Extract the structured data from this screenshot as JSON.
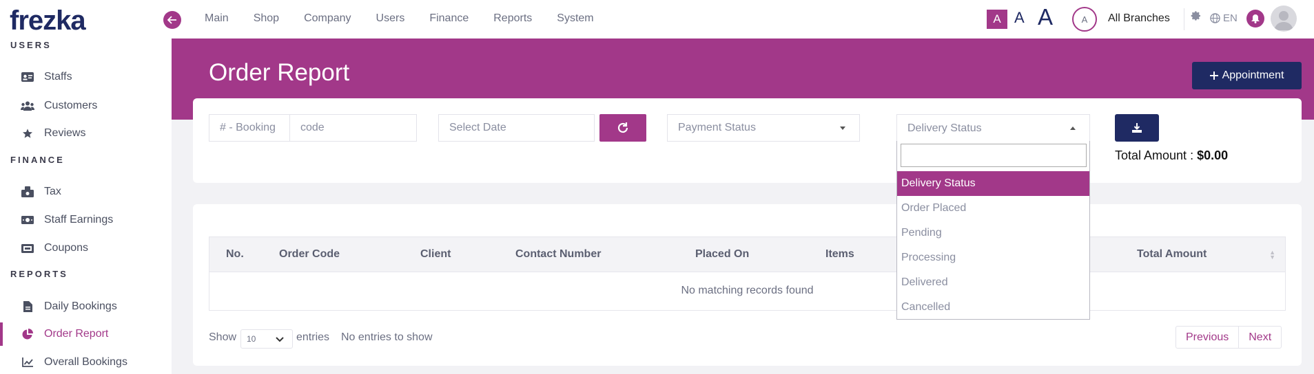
{
  "brand": {
    "logo": "frezka"
  },
  "sidebar": {
    "sections": [
      {
        "header": "USERS",
        "items": [
          {
            "label": "Staffs",
            "icon": "id-card-icon"
          },
          {
            "label": "Customers",
            "icon": "users-icon"
          },
          {
            "label": "Reviews",
            "icon": "star-icon"
          }
        ]
      },
      {
        "header": "FINANCE",
        "items": [
          {
            "label": "Tax",
            "icon": "tax-icon"
          },
          {
            "label": "Staff Earnings",
            "icon": "money-icon"
          },
          {
            "label": "Coupons",
            "icon": "ticket-icon"
          }
        ]
      },
      {
        "header": "REPORTS",
        "items": [
          {
            "label": "Daily Bookings",
            "icon": "file-icon"
          },
          {
            "label": "Order Report",
            "icon": "pie-chart-icon",
            "active": true
          },
          {
            "label": "Overall Bookings",
            "icon": "line-chart-icon"
          }
        ]
      }
    ]
  },
  "topnav": {
    "items": [
      "Main",
      "Shop",
      "Company",
      "Users",
      "Finance",
      "Reports",
      "System"
    ]
  },
  "topbar": {
    "font_sizes": [
      "A",
      "A",
      "A"
    ],
    "branch_avatar": "A",
    "branch_label": "All Branches",
    "language": "EN"
  },
  "page": {
    "title": "Order Report",
    "appointment_button": "Appointment"
  },
  "filters": {
    "booking_prefix": "# - Booking",
    "code_placeholder": "code",
    "date_placeholder": "Select Date",
    "payment_status": "Payment Status",
    "delivery_status": "Delivery Status",
    "total_label": "Total Amount :",
    "total_value": "$0.00"
  },
  "dropdown": {
    "options": [
      "Delivery Status",
      "Order Placed",
      "Pending",
      "Processing",
      "Delivered",
      "Cancelled"
    ],
    "selected": "Delivery Status"
  },
  "table": {
    "columns": [
      "No.",
      "Order Code",
      "Client",
      "Contact Number",
      "Placed On",
      "Items",
      "Total Amount"
    ],
    "empty_message": "No matching records found"
  },
  "footer": {
    "show_label": "Show",
    "page_size": "10",
    "entries_label": "entries",
    "info": "No entries to show",
    "prev": "Previous",
    "next": "Next"
  },
  "colors": {
    "accent": "#a23889",
    "navy": "#1f2a63"
  }
}
